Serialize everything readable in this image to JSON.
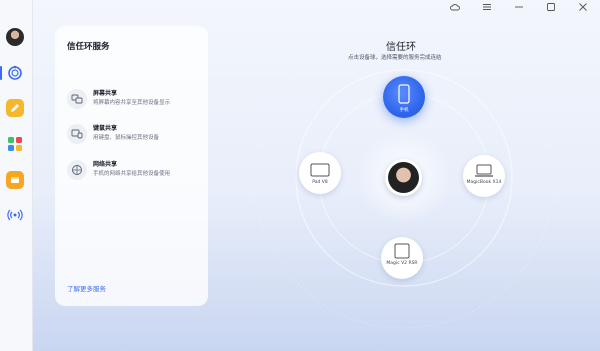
{
  "window": {
    "controls": [
      "cloud",
      "menu",
      "minimize",
      "restore",
      "close"
    ]
  },
  "sidebar": {
    "items": [
      {
        "name": "avatar"
      },
      {
        "name": "trust-ring-icon",
        "active": true
      },
      {
        "name": "pencil-icon"
      },
      {
        "name": "apps-icon"
      },
      {
        "name": "box-icon"
      },
      {
        "name": "signal-icon"
      }
    ]
  },
  "services_card": {
    "title": "信任环服务",
    "items": [
      {
        "name": "屏幕共享",
        "desc": "将屏幕内容共享至其他设备显示",
        "icon": "screen-share-icon"
      },
      {
        "name": "键鼠共享",
        "desc": "用键盘、鼠标操控其他设备",
        "icon": "keyboard-mouse-icon"
      },
      {
        "name": "网络共享",
        "desc": "手机的网络共享给其他设备使用",
        "icon": "network-share-icon"
      }
    ],
    "more_link": "了解更多服务"
  },
  "trust_ring": {
    "title": "信任环",
    "subtitle": "点击设备球，选择需要的服务完成连结",
    "devices": {
      "phone": "手机",
      "pad": "Pad V8",
      "magicbook": "MagicBook X14",
      "magic_v2": "Magic V2 RSR"
    }
  },
  "colors": {
    "accent": "#3b6df0",
    "phone_bubble": "#2f66ec"
  }
}
